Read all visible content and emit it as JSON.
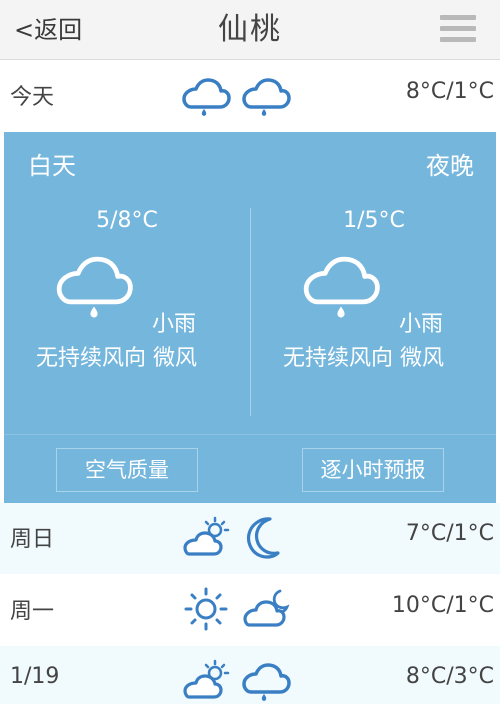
{
  "header": {
    "back_label": "<返回",
    "city": "仙桃"
  },
  "today": {
    "label": "今天",
    "day_icon": "rain-cloud-icon",
    "night_icon": "rain-cloud-icon",
    "temp": "8°C/1°C"
  },
  "detail": {
    "day_title": "白天",
    "night_title": "夜晚",
    "day": {
      "range": "5/8°C",
      "icon": "rain-cloud-icon",
      "condition": "小雨",
      "wind": "无持续风向 微风"
    },
    "night": {
      "range": "1/5°C",
      "icon": "rain-cloud-icon",
      "condition": "小雨",
      "wind": "无持续风向 微风"
    },
    "air_quality_label": "空气质量",
    "hourly_label": "逐小时预报"
  },
  "forecast": [
    {
      "label": "周日",
      "day_icon": "partly-cloudy-sun-icon",
      "night_icon": "crescent-moon-icon",
      "temp": "7°C/1°C"
    },
    {
      "label": "周一",
      "day_icon": "sun-icon",
      "night_icon": "cloudy-moon-icon",
      "temp": "10°C/1°C"
    },
    {
      "label": "1/19",
      "day_icon": "partly-cloudy-sun-icon",
      "night_icon": "rain-cloud-icon",
      "temp": "8°C/3°C"
    }
  ],
  "colors": {
    "icon_blue": "#3a7fc4",
    "panel_blue": "#75b6dd",
    "row_tint": "#f1fafd"
  }
}
